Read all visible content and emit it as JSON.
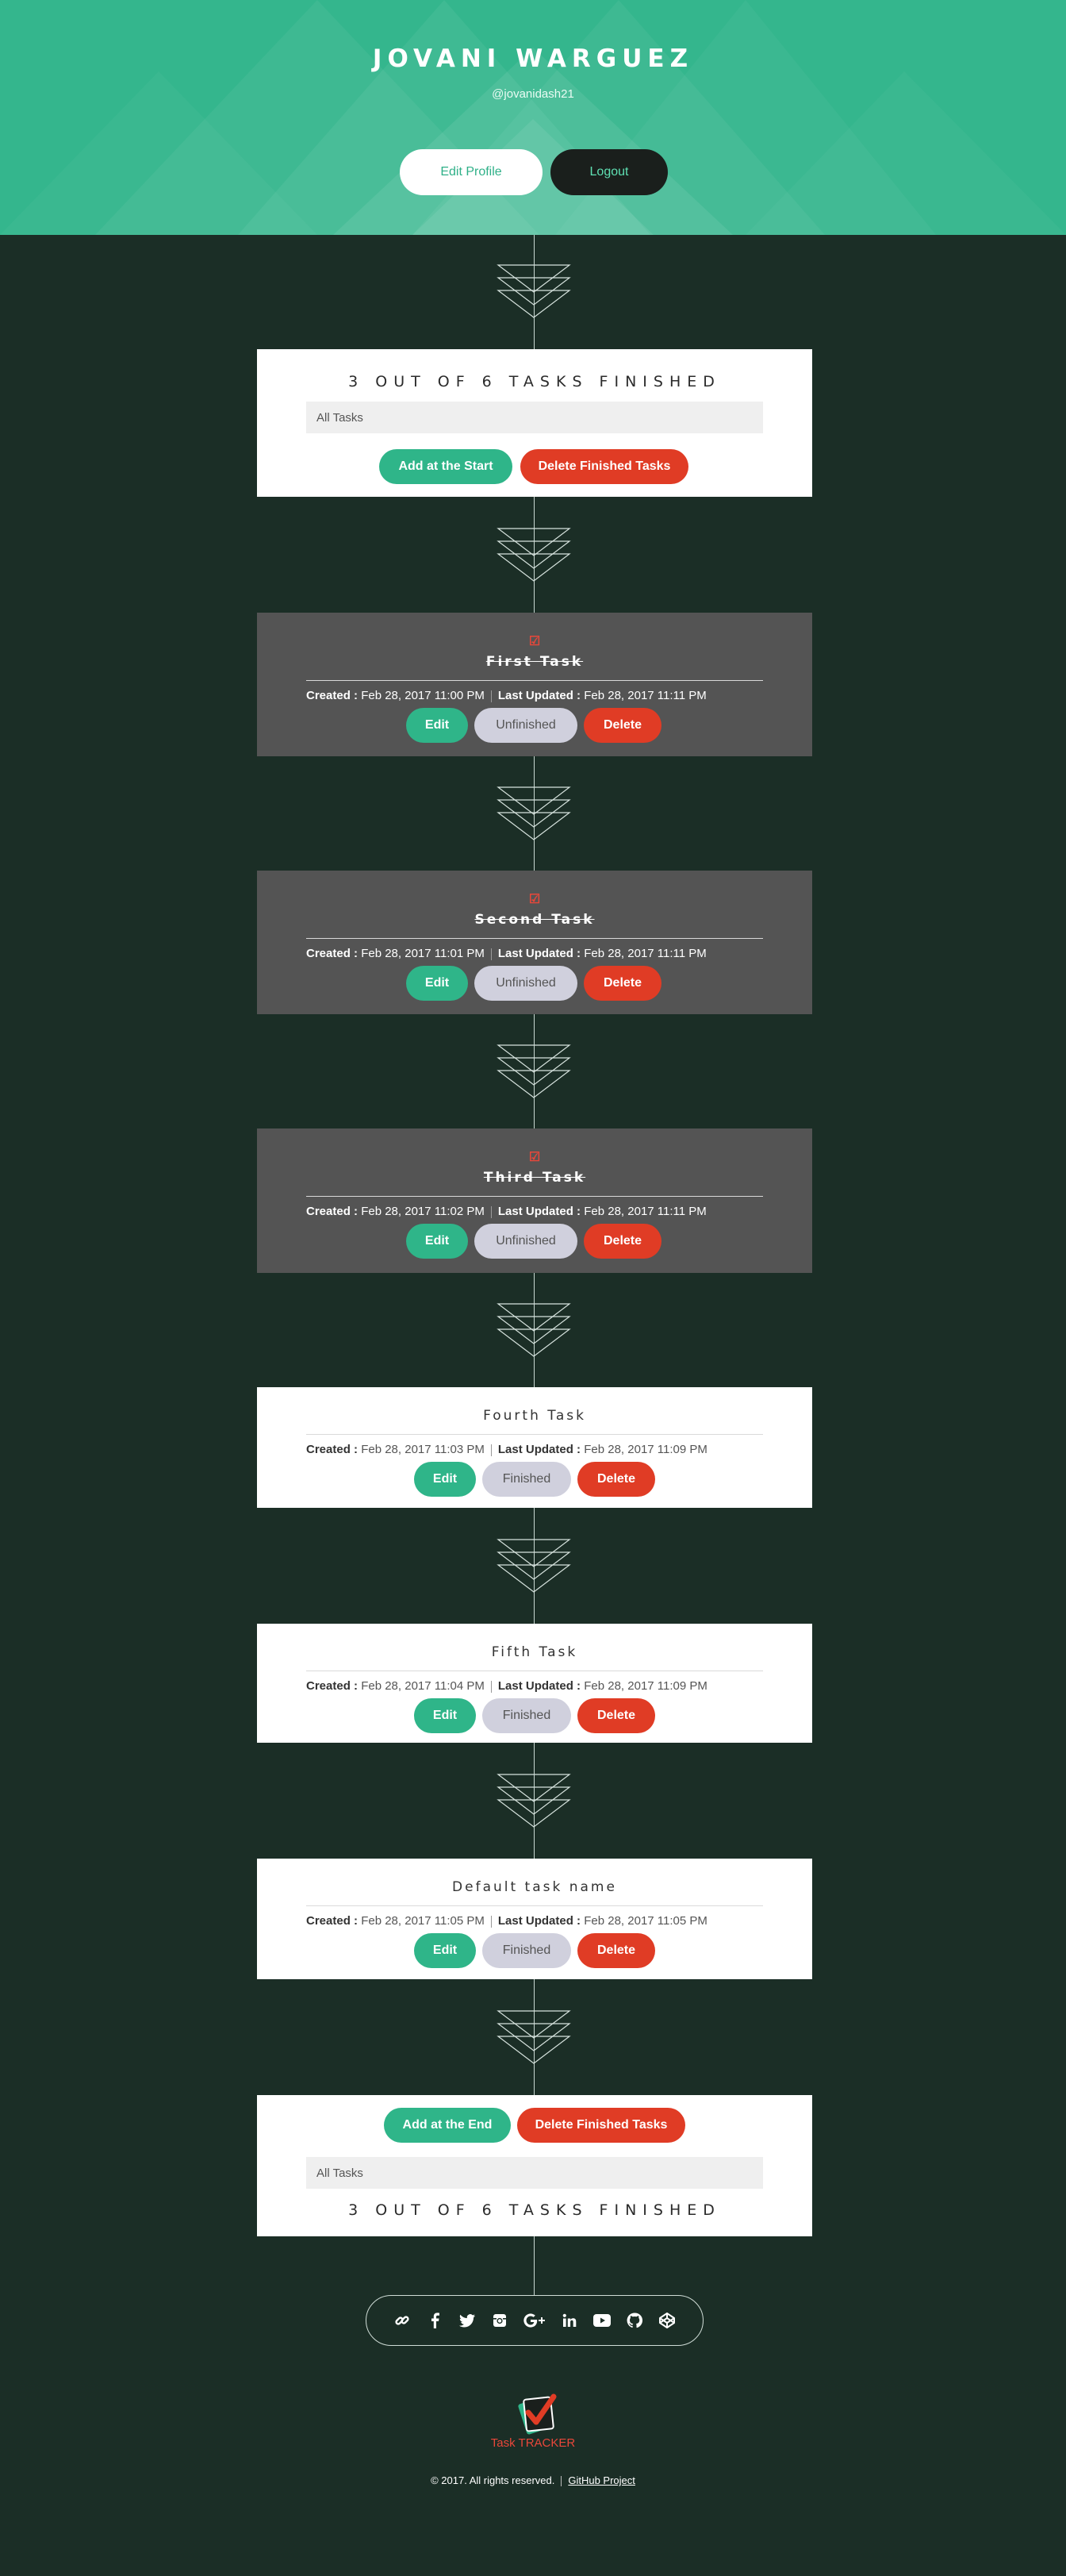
{
  "header": {
    "name": "JOVANI WARGUEZ",
    "handle": "@jovanidash21",
    "edit_profile_label": "Edit Profile",
    "logout_label": "Logout"
  },
  "summary_top": {
    "title": "3 OUT OF 6 TASKS FINISHED",
    "filter": "All Tasks",
    "add_label": "Add at the Start",
    "delete_finished_label": "Delete Finished Tasks"
  },
  "tasks": [
    {
      "name": "First Task",
      "finished": true,
      "created_label": "Created :",
      "created": "Feb 28, 2017 11:00 PM",
      "updated_label": "Last Updated :",
      "updated": "Feb 28, 2017 11:11 PM",
      "edit_label": "Edit",
      "toggle_label": "Unfinished",
      "delete_label": "Delete"
    },
    {
      "name": "Second Task",
      "finished": true,
      "created_label": "Created :",
      "created": "Feb 28, 2017 11:01 PM",
      "updated_label": "Last Updated :",
      "updated": "Feb 28, 2017 11:11 PM",
      "edit_label": "Edit",
      "toggle_label": "Unfinished",
      "delete_label": "Delete"
    },
    {
      "name": "Third Task",
      "finished": true,
      "created_label": "Created :",
      "created": "Feb 28, 2017 11:02 PM",
      "updated_label": "Last Updated :",
      "updated": "Feb 28, 2017 11:11 PM",
      "edit_label": "Edit",
      "toggle_label": "Unfinished",
      "delete_label": "Delete"
    },
    {
      "name": "Fourth Task",
      "finished": false,
      "created_label": "Created :",
      "created": "Feb 28, 2017 11:03 PM",
      "updated_label": "Last Updated :",
      "updated": "Feb 28, 2017 11:09 PM",
      "edit_label": "Edit",
      "toggle_label": "Finished",
      "delete_label": "Delete"
    },
    {
      "name": "Fifth Task",
      "finished": false,
      "created_label": "Created :",
      "created": "Feb 28, 2017 11:04 PM",
      "updated_label": "Last Updated :",
      "updated": "Feb 28, 2017 11:09 PM",
      "edit_label": "Edit",
      "toggle_label": "Finished",
      "delete_label": "Delete"
    },
    {
      "name": "Default task name",
      "finished": false,
      "created_label": "Created :",
      "created": "Feb 28, 2017 11:05 PM",
      "updated_label": "Last Updated :",
      "updated": "Feb 28, 2017 11:05 PM",
      "edit_label": "Edit",
      "toggle_label": "Finished",
      "delete_label": "Delete"
    }
  ],
  "summary_bottom": {
    "add_label": "Add at the End",
    "delete_finished_label": "Delete Finished Tasks",
    "filter": "All Tasks",
    "title": "3 OUT OF 6 TASKS FINISHED"
  },
  "social_icons": [
    "link-icon",
    "facebook-icon",
    "twitter-icon",
    "instagram-icon",
    "google-plus-icon",
    "linkedin-icon",
    "youtube-icon",
    "github-icon",
    "codepen-icon"
  ],
  "logo": {
    "text_task": "Task",
    "text_tracker": "TRACKER"
  },
  "footer": {
    "copyright": "© 2017. All rights reserved.",
    "github_link": "GitHub Project"
  },
  "colors": {
    "brand_green": "#34b68d",
    "background": "#1b2e26",
    "delete_red": "#e03c25",
    "finished_card": "#545454"
  }
}
